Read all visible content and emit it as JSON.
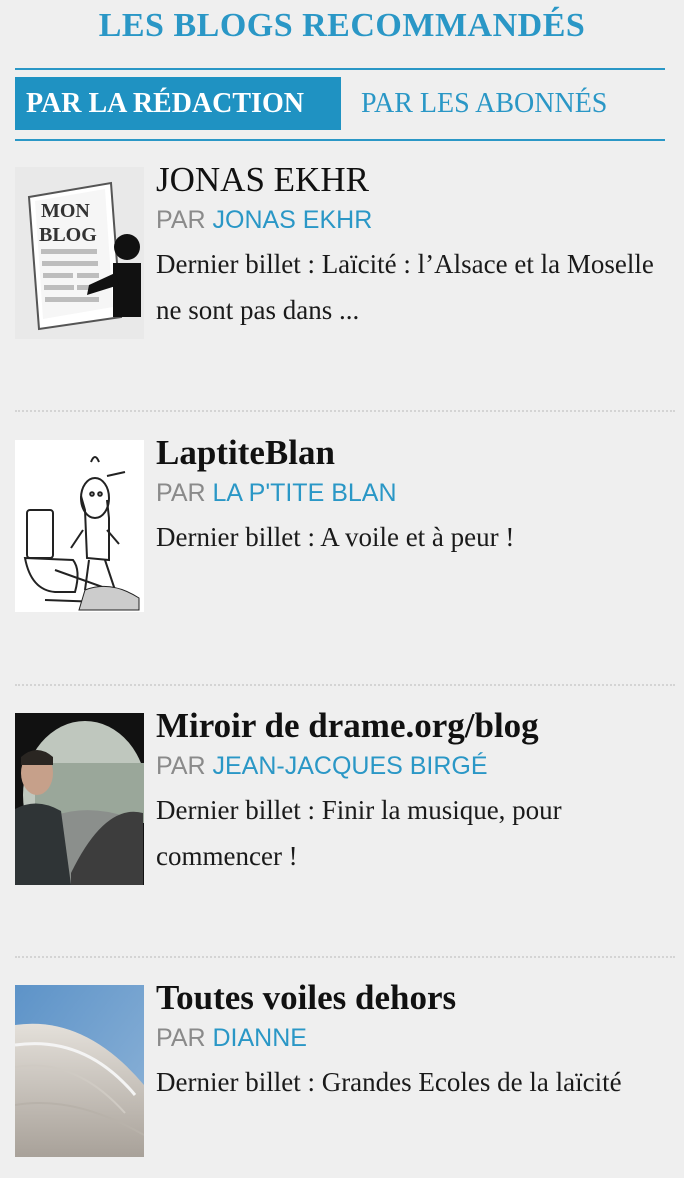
{
  "header": {
    "title": "LES BLOGS RECOMMANDÉS"
  },
  "tabs": {
    "active": "PAR LA RÉDACTION",
    "inactive": "PAR LES ABONNÉS"
  },
  "blogs": [
    {
      "title": "JONAS EKHR",
      "by": "PAR ",
      "author": "JONAS EKHR",
      "excerpt": "Dernier billet : Laïcité : l’Alsace et la Moselle ne sont pas dans ...",
      "thumb_text_1": "MON",
      "thumb_text_2": "BLOG"
    },
    {
      "title": "LaptiteBlan",
      "by": "PAR ",
      "author": "LA P'TITE BLAN",
      "excerpt": "Dernier billet : A voile et à peur !"
    },
    {
      "title": "Miroir de drame.org/blog",
      "by": "PAR ",
      "author": "JEAN-JACQUES BIRGÉ",
      "excerpt": "Dernier billet : Finir la musique, pour commencer !"
    },
    {
      "title": "Toutes voiles dehors",
      "by": "PAR ",
      "author": "DIANNE",
      "excerpt": "Dernier billet : Grandes Ecoles de la laïcité"
    }
  ],
  "colors": {
    "accent": "#2a97c6",
    "tab_active_bg": "#1f92c2",
    "page_bg": "#efefef",
    "byline_gray": "#8a8a8a"
  }
}
